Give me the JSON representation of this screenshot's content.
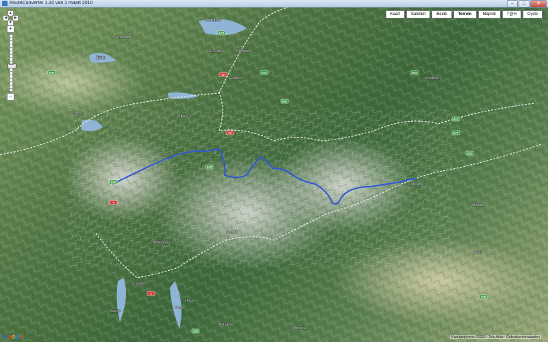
{
  "window": {
    "title": "RouteConverter 1.32 van 1 maart 2010",
    "minimize_glyph": "–",
    "maximize_glyph": "□",
    "close_glyph": "✕"
  },
  "map_types": [
    {
      "label": "Kaart",
      "active": false
    },
    {
      "label": "Satelliet",
      "active": false
    },
    {
      "label": "Beide",
      "active": false
    },
    {
      "label": "Terrein",
      "active": true
    },
    {
      "label": "Mapnik",
      "active": false
    },
    {
      "label": "T@H",
      "active": false
    },
    {
      "label": "Cycle",
      "active": false
    }
  ],
  "controls": {
    "pan_up": "▲",
    "pan_down": "▼",
    "pan_left": "◀",
    "pan_right": "▶",
    "zoom_in": "+",
    "zoom_out": "−",
    "zoom_level": 0.55
  },
  "copyright": "Kaartgegevens ©2010 - Tele Atlas - Gebruiksvoorwaarden",
  "logo": {
    "letters": [
      "G",
      "o",
      "o",
      "g",
      "l",
      "e"
    ],
    "colors": [
      "#3b6ed8",
      "#d8402c",
      "#e8b423",
      "#3b6ed8",
      "#2f9a45",
      "#d8402c"
    ]
  },
  "place_labels": [
    {
      "name": "Winterthur"
    },
    {
      "name": "Zürich"
    },
    {
      "name": "St. Gallen"
    },
    {
      "name": "Dornbirn"
    },
    {
      "name": "Bodensee"
    },
    {
      "name": "Feldkirch"
    },
    {
      "name": "Innsbruck"
    },
    {
      "name": "Luzern"
    },
    {
      "name": "Chur"
    },
    {
      "name": "Locarno"
    },
    {
      "name": "Merano"
    },
    {
      "name": "Bolzano"
    },
    {
      "name": "Sondrio"
    },
    {
      "name": "Como"
    },
    {
      "name": "Bergamo"
    },
    {
      "name": "Trento"
    },
    {
      "name": "Brescia"
    },
    {
      "name": "Lecco"
    },
    {
      "name": "Varese"
    },
    {
      "name": "Bellinzona"
    }
  ],
  "road_shields": [
    {
      "label": "E43"
    },
    {
      "label": "E41"
    },
    {
      "label": "E60"
    },
    {
      "label": "E45"
    },
    {
      "label": "A12"
    },
    {
      "label": "A13"
    },
    {
      "label": "E35"
    },
    {
      "label": "E62"
    },
    {
      "label": "A22"
    },
    {
      "label": "S36"
    },
    {
      "label": "E70"
    },
    {
      "label": "S38"
    },
    {
      "label": "13"
    },
    {
      "label": "2"
    },
    {
      "label": "4"
    },
    {
      "label": "19"
    }
  ],
  "colors": {
    "route": "#2f57d8",
    "border": "#f2f2f2",
    "lake": "#8fb4d6",
    "motorway_shield": "#3f9a3f",
    "national_shield": "#d8403a"
  }
}
